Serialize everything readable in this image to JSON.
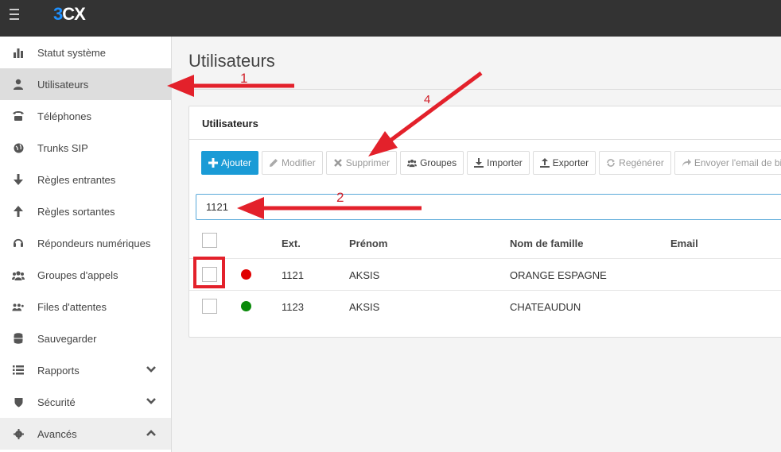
{
  "app": {
    "logo_prefix": "3",
    "logo_suffix": "CX",
    "brand_color": "#1a9bd6"
  },
  "sidebar": {
    "items": [
      {
        "label": "Statut système",
        "icon": "bar-chart-icon"
      },
      {
        "label": "Utilisateurs",
        "icon": "user-icon",
        "active": true
      },
      {
        "label": "Téléphones",
        "icon": "phone-icon"
      },
      {
        "label": "Trunks SIP",
        "icon": "globe-icon"
      },
      {
        "label": "Règles entrantes",
        "icon": "arrow-down-icon"
      },
      {
        "label": "Règles sortantes",
        "icon": "arrow-up-icon"
      },
      {
        "label": "Répondeurs numériques",
        "icon": "headset-icon"
      },
      {
        "label": "Groupes d'appels",
        "icon": "group-icon"
      },
      {
        "label": "Files d'attentes",
        "icon": "queue-icon"
      },
      {
        "label": "Sauvegarder",
        "icon": "database-icon"
      },
      {
        "label": "Rapports",
        "icon": "list-icon"
      },
      {
        "label": "Sécurité",
        "icon": "shield-icon"
      },
      {
        "label": "Avancés",
        "icon": "gear-icon"
      }
    ]
  },
  "main": {
    "page_title": "Utilisateurs",
    "panel_title": "Utilisateurs",
    "toolbar": {
      "add": "Ajouter",
      "edit": "Modifier",
      "delete": "Supprimer",
      "groups": "Groupes",
      "import": "Importer",
      "export": "Exporter",
      "regenerate": "Regénérer",
      "send_email": "Envoyer l'email de bien"
    },
    "search_value": "1121",
    "table": {
      "columns": {
        "ext": "Ext.",
        "first_name": "Prénom",
        "last_name": "Nom de famille",
        "email": "Email"
      },
      "rows": [
        {
          "ext": "1121",
          "first_name": "AKSIS",
          "last_name": "ORANGE ESPAGNE",
          "email": "",
          "status_color": "#e00000"
        },
        {
          "ext": "1123",
          "first_name": "AKSIS",
          "last_name": "CHATEAUDUN",
          "email": "",
          "status_color": "#0a8a0a"
        }
      ]
    }
  },
  "annotations": {
    "n1": "1",
    "n2": "2",
    "n4": "4",
    "color": "#e3212b"
  }
}
